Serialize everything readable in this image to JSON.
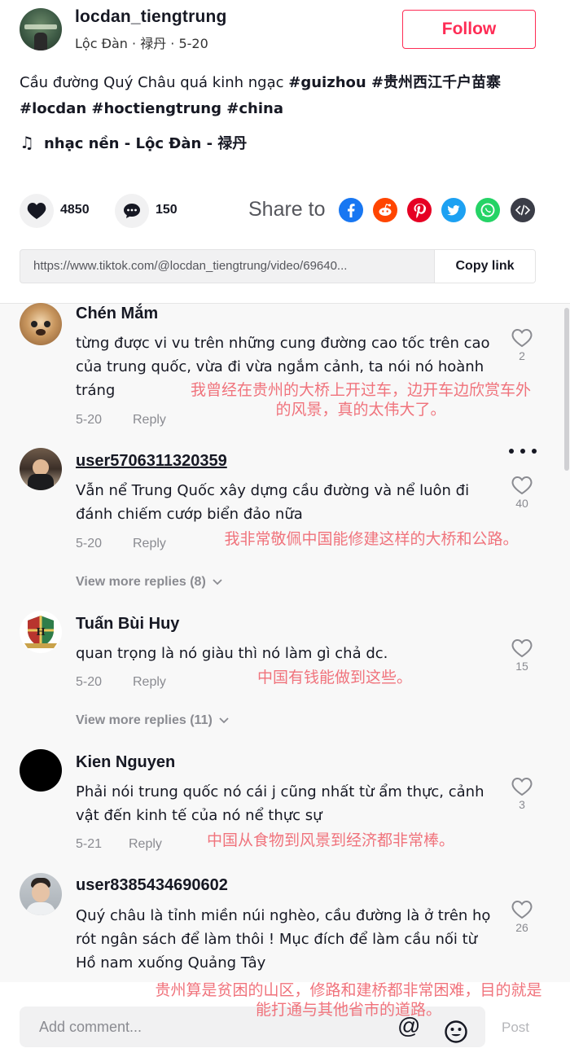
{
  "header": {
    "username": "locdan_tiengtrung",
    "subline": "Lộc Đàn · 禄丹 · 5-20",
    "follow_label": "Follow",
    "caption_text": "Cầu đường Quý Châu quá kinh ngạc",
    "caption_tags_1": "#guizhou #贵州西江千户苗寨",
    "caption_tags_2": "#locdan #hoctiengtrung #china",
    "music": "nhạc nền - Lộc Đàn - 禄丹"
  },
  "actions": {
    "likes": "4850",
    "comments": "150",
    "share_label": "Share to",
    "link_url": "https://www.tiktok.com/@locdan_tiengtrung/video/69640...",
    "copy_label": "Copy link"
  },
  "comments": [
    {
      "name": "Chén Mắm",
      "text": "từng được vi vu trên những cung đường cao tốc trên cao của trung quốc, vừa đi vừa ngắm cảnh, ta nói nó hoành tráng",
      "date": "5-20",
      "reply": "Reply",
      "likes": "2",
      "zh": "我曾经在贵州的大桥上开过车，边开车边欣赏车外的风景，真的太伟大了。"
    },
    {
      "name": "user5706311320359",
      "text": "Vẫn nể Trung Quốc xây dựng cầu đường và nể luôn đi đánh chiếm cướp biển đảo nữa",
      "date": "5-20",
      "reply": "Reply",
      "likes": "40",
      "zh": "我非常敬佩中国能修建这样的大桥和公路。",
      "more": "View more replies (8)"
    },
    {
      "name": "Tuấn Bùi Huy",
      "text": "quan trọng là nó giàu thì nó làm gì chả dc.",
      "date": "5-20",
      "reply": "Reply",
      "likes": "15",
      "zh": "中国有钱能做到这些。",
      "more": "View more replies (11)"
    },
    {
      "name": "Kien Nguyen",
      "text": "Phải nói trung quốc nó cái j cũng nhất từ ẩm thực, cảnh vật đến kinh tế của nó nể thực sự",
      "date": "5-21",
      "reply": "Reply",
      "likes": "3",
      "zh": "中国从食物到风景到经济都非常棒。"
    },
    {
      "name": "user8385434690602",
      "text": "Quý châu là tỉnh miền núi nghèo, cầu đường là ở trên họ rót ngân sách để làm thôi ! Mục đích để làm cầu nối từ Hồ nam xuống Quảng Tây",
      "likes": "26",
      "zh": "贵州算是贫困的山区，修路和建桥都非常困难，目的就是能打通与其他省市的道路。"
    }
  ],
  "footer": {
    "placeholder": "Add comment...",
    "post_label": "Post"
  },
  "colors": {
    "accent": "#fe2c55",
    "annotation": "#f0737c",
    "muted": "#8a8b91"
  }
}
